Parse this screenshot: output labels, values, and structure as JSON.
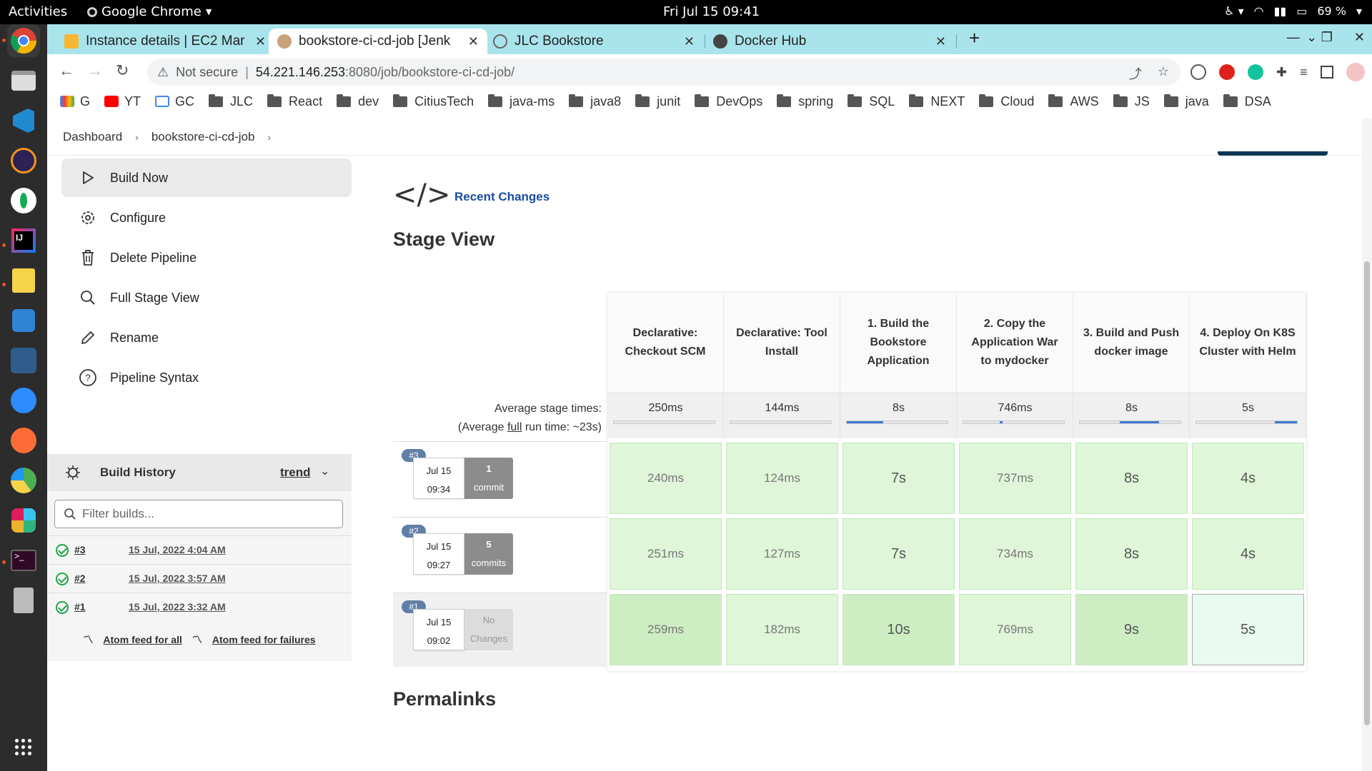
{
  "topbar": {
    "activities": "Activities",
    "app_name": "Google Chrome",
    "clock": "Fri Jul 15  09:41",
    "battery": "69 %"
  },
  "browser": {
    "tabs": [
      {
        "label": "Instance details | EC2 Mar",
        "favicon_color": "#f7b731"
      },
      {
        "label": "bookstore-ci-cd-job [Jenk",
        "favicon_color": "#c8a27a"
      },
      {
        "label": "JLC Bookstore",
        "favicon_color": "#777777"
      },
      {
        "label": "Docker Hub",
        "favicon_color": "#444444"
      }
    ],
    "not_secure": "Not secure",
    "url_host": "54.221.146.253",
    "url_path": ":8080/job/bookstore-ci-cd-job/",
    "bookmarks": [
      {
        "label": "G",
        "type": "gmail"
      },
      {
        "label": "YT",
        "type": "youtube"
      },
      {
        "label": "GC",
        "type": "calendar"
      },
      {
        "label": "JLC",
        "type": "folder"
      },
      {
        "label": "React",
        "type": "folder"
      },
      {
        "label": "dev",
        "type": "folder"
      },
      {
        "label": "CitiusTech",
        "type": "folder"
      },
      {
        "label": "java-ms",
        "type": "folder"
      },
      {
        "label": "java8",
        "type": "folder"
      },
      {
        "label": "junit",
        "type": "folder"
      },
      {
        "label": "DevOps",
        "type": "folder"
      },
      {
        "label": "spring",
        "type": "folder"
      },
      {
        "label": "SQL",
        "type": "folder"
      },
      {
        "label": "NEXT",
        "type": "folder"
      },
      {
        "label": "Cloud",
        "type": "folder"
      },
      {
        "label": "AWS",
        "type": "folder"
      },
      {
        "label": "JS",
        "type": "folder"
      },
      {
        "label": "java",
        "type": "folder"
      },
      {
        "label": "DSA",
        "type": "folder"
      }
    ]
  },
  "breadcrumb": {
    "dashboard": "Dashboard",
    "job": "bookstore-ci-cd-job"
  },
  "sidebar": {
    "tasks": [
      {
        "label": "Build Now",
        "icon": "play-icon"
      },
      {
        "label": "Configure",
        "icon": "gear-icon"
      },
      {
        "label": "Delete Pipeline",
        "icon": "trash-icon"
      },
      {
        "label": "Full Stage View",
        "icon": "search-icon"
      },
      {
        "label": "Rename",
        "icon": "pencil-icon"
      },
      {
        "label": "Pipeline Syntax",
        "icon": "help-icon"
      }
    ],
    "build_history": {
      "title": "Build History",
      "trend": "trend",
      "filter_placeholder": "Filter builds...",
      "builds": [
        {
          "number": "#3",
          "date": "15 Jul, 2022 4:04 AM"
        },
        {
          "number": "#2",
          "date": "15 Jul, 2022 3:57 AM"
        },
        {
          "number": "#1",
          "date": "15 Jul, 2022 3:32 AM"
        }
      ],
      "feed_all": "Atom feed for all",
      "feed_failures": "Atom feed for failures"
    }
  },
  "main": {
    "recent_changes": "Recent Changes",
    "stage_view_title": "Stage View",
    "permalinks_title": "Permalinks",
    "avg_label_1": "Average stage times:",
    "avg_label_2a": "(Average ",
    "avg_label_2b": "full",
    "avg_label_2c": " run time: ~23s)",
    "stages": [
      {
        "name": "Declarative: Checkout SCM",
        "avg": "250ms",
        "bar_start": 0.0,
        "bar_fill": 0.0
      },
      {
        "name": "Declarative: Tool Install",
        "avg": "144ms",
        "bar_start": 0.0,
        "bar_fill": 0.0
      },
      {
        "name": "1. Build the Bookstore Application",
        "avg": "8s",
        "bar_start": 0.0,
        "bar_fill": 0.36
      },
      {
        "name": "2. Copy the Application War to mydocker",
        "avg": "746ms",
        "bar_start": 0.36,
        "bar_fill": 0.03
      },
      {
        "name": "3. Build and Push docker image",
        "avg": "8s",
        "bar_start": 0.4,
        "bar_fill": 0.39
      },
      {
        "name": "4. Deploy On K8S Cluster with Helm",
        "avg": "5s",
        "bar_start": 0.78,
        "bar_fill": 0.22
      }
    ],
    "runs": [
      {
        "badge": "#3",
        "date": "Jul 15",
        "time": "09:34",
        "changes_count": "1",
        "changes_label": "commit",
        "cells": [
          "240ms",
          "124ms",
          "7s",
          "737ms",
          "8s",
          "4s"
        ]
      },
      {
        "badge": "#2",
        "date": "Jul 15",
        "time": "09:27",
        "changes_count": "5",
        "changes_label": "commits",
        "cells": [
          "251ms",
          "127ms",
          "7s",
          "734ms",
          "8s",
          "4s"
        ]
      },
      {
        "badge": "#1",
        "date": "Jul 15",
        "time": "09:02",
        "changes_count": "No",
        "changes_label": "Changes",
        "cells": [
          "259ms",
          "182ms",
          "10s",
          "769ms",
          "9s",
          "5s"
        ]
      }
    ]
  }
}
